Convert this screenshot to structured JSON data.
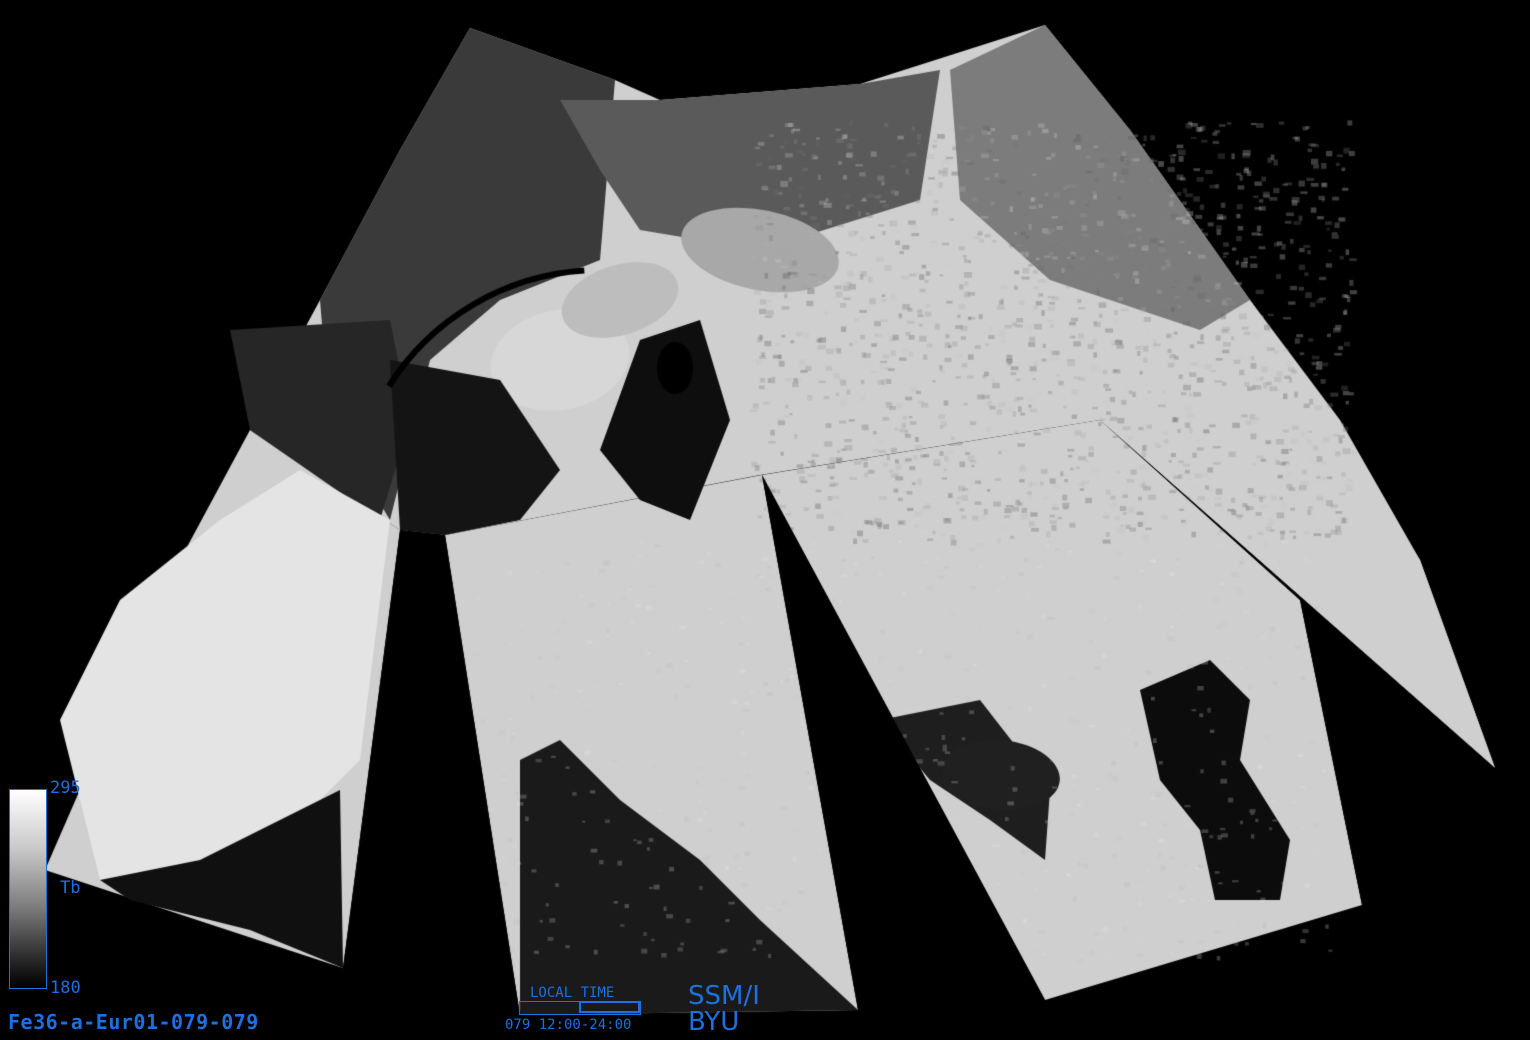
{
  "image": {
    "description_kind": "satellite brightness temperature swath composite",
    "file_id": "Fe36-a-Eur01-079-079",
    "sensor": "SSM/I",
    "institution": "BYU"
  },
  "colorbar": {
    "max_label": "295",
    "min_label": "180",
    "variable_label": "Tb",
    "max_value": 295,
    "min_value": 180
  },
  "local_time": {
    "label": "LOCAL TIME",
    "range": "079  12:00-24:00"
  },
  "colors": {
    "background": "#000000",
    "annotation": "#1e6fe0"
  }
}
